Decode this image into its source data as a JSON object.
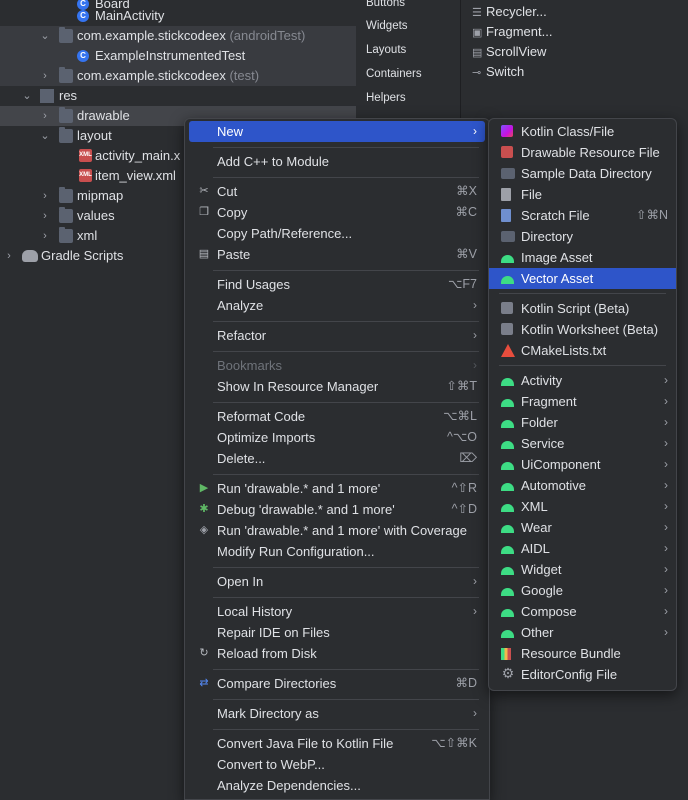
{
  "project_tree": {
    "rows": [
      {
        "label": "Board",
        "suffix": ""
      },
      {
        "label": "MainActivity",
        "suffix": ""
      },
      {
        "label": "com.example.stickcodeex",
        "suffix": "(androidTest)"
      },
      {
        "label": "ExampleInstrumentedTest",
        "suffix": ""
      },
      {
        "label": "com.example.stickcodeex",
        "suffix": "(test)"
      },
      {
        "label": "res",
        "suffix": ""
      },
      {
        "label": "drawable",
        "suffix": ""
      },
      {
        "label": "layout",
        "suffix": ""
      },
      {
        "label": "activity_main.x",
        "suffix": ""
      },
      {
        "label": "item_view.xml",
        "suffix": ""
      },
      {
        "label": "mipmap",
        "suffix": ""
      },
      {
        "label": "values",
        "suffix": ""
      },
      {
        "label": "xml",
        "suffix": ""
      },
      {
        "label": "Gradle Scripts",
        "suffix": ""
      }
    ]
  },
  "palette": {
    "categories": [
      "Buttons",
      "Widgets",
      "Layouts",
      "Containers",
      "Helpers"
    ],
    "items": [
      "Recycler...",
      "Fragment...",
      "ScrollView",
      "Switch"
    ]
  },
  "context_menu": {
    "items": [
      {
        "label": "New",
        "shortcut": "",
        "submenu": true,
        "highlighted": true
      },
      {
        "label": "Add C++ to Module",
        "shortcut": ""
      },
      {
        "label": "Cut",
        "shortcut": "⌘X",
        "icon": "scissors-icon"
      },
      {
        "label": "Copy",
        "shortcut": "⌘C",
        "icon": "copy-icon"
      },
      {
        "label": "Copy Path/Reference...",
        "shortcut": ""
      },
      {
        "label": "Paste",
        "shortcut": "⌘V",
        "icon": "paste-icon"
      },
      {
        "label": "Find Usages",
        "shortcut": "⌥F7"
      },
      {
        "label": "Analyze",
        "shortcut": "",
        "submenu": true
      },
      {
        "label": "Refactor",
        "shortcut": "",
        "submenu": true
      },
      {
        "label": "Bookmarks",
        "shortcut": "",
        "submenu": true,
        "disabled": true
      },
      {
        "label": "Show In Resource Manager",
        "shortcut": "⇧⌘T"
      },
      {
        "label": "Reformat Code",
        "shortcut": "⌥⌘L"
      },
      {
        "label": "Optimize Imports",
        "shortcut": "^⌥O"
      },
      {
        "label": "Delete...",
        "shortcut": "⌦"
      },
      {
        "label": "Run 'drawable.* and 1 more'",
        "shortcut": "^⇧R",
        "icon": "run-icon"
      },
      {
        "label": "Debug 'drawable.* and 1 more'",
        "shortcut": "^⇧D",
        "icon": "debug-icon"
      },
      {
        "label": "Run 'drawable.* and 1 more' with Coverage",
        "shortcut": "",
        "icon": "coverage-icon"
      },
      {
        "label": "Modify Run Configuration...",
        "shortcut": ""
      },
      {
        "label": "Open In",
        "shortcut": "",
        "submenu": true
      },
      {
        "label": "Local History",
        "shortcut": "",
        "submenu": true
      },
      {
        "label": "Repair IDE on Files",
        "shortcut": ""
      },
      {
        "label": "Reload from Disk",
        "shortcut": "",
        "icon": "reload-icon"
      },
      {
        "label": "Compare Directories",
        "shortcut": "⌘D",
        "icon": "compare-icon"
      },
      {
        "label": "Mark Directory as",
        "shortcut": "",
        "submenu": true
      },
      {
        "label": "Convert Java File to Kotlin File",
        "shortcut": "⌥⇧⌘K"
      },
      {
        "label": "Convert to WebP...",
        "shortcut": ""
      },
      {
        "label": "Analyze Dependencies...",
        "shortcut": ""
      }
    ]
  },
  "new_submenu": {
    "items": [
      {
        "label": "Kotlin Class/File",
        "shortcut": "",
        "icon": "kotlin-file-icon"
      },
      {
        "label": "Drawable Resource File",
        "shortcut": "",
        "icon": "drawable-resource-icon"
      },
      {
        "label": "Sample Data Directory",
        "shortcut": "",
        "icon": "folder-icon"
      },
      {
        "label": "File",
        "shortcut": "",
        "icon": "file-icon"
      },
      {
        "label": "Scratch File",
        "shortcut": "⇧⌘N",
        "icon": "scratch-file-icon"
      },
      {
        "label": "Directory",
        "shortcut": "",
        "icon": "folder-icon"
      },
      {
        "label": "Image Asset",
        "shortcut": "",
        "icon": "android-icon"
      },
      {
        "label": "Vector Asset",
        "shortcut": "",
        "icon": "android-icon",
        "highlighted": true
      },
      {
        "label": "Kotlin Script (Beta)",
        "shortcut": "",
        "icon": "kotlin-script-icon"
      },
      {
        "label": "Kotlin Worksheet (Beta)",
        "shortcut": "",
        "icon": "kotlin-worksheet-icon"
      },
      {
        "label": "CMakeLists.txt",
        "shortcut": "",
        "icon": "cmake-icon"
      },
      {
        "label": "Activity",
        "submenu": true,
        "icon": "android-icon"
      },
      {
        "label": "Fragment",
        "submenu": true,
        "icon": "android-icon"
      },
      {
        "label": "Folder",
        "submenu": true,
        "icon": "android-icon"
      },
      {
        "label": "Service",
        "submenu": true,
        "icon": "android-icon"
      },
      {
        "label": "UiComponent",
        "submenu": true,
        "icon": "android-icon"
      },
      {
        "label": "Automotive",
        "submenu": true,
        "icon": "android-icon"
      },
      {
        "label": "XML",
        "submenu": true,
        "icon": "android-icon"
      },
      {
        "label": "Wear",
        "submenu": true,
        "icon": "android-icon"
      },
      {
        "label": "AIDL",
        "submenu": true,
        "icon": "android-icon"
      },
      {
        "label": "Widget",
        "submenu": true,
        "icon": "android-icon"
      },
      {
        "label": "Google",
        "submenu": true,
        "icon": "android-icon"
      },
      {
        "label": "Compose",
        "submenu": true,
        "icon": "android-icon"
      },
      {
        "label": "Other",
        "submenu": true,
        "icon": "android-icon"
      },
      {
        "label": "Resource Bundle",
        "shortcut": "",
        "icon": "resource-bundle-icon"
      },
      {
        "label": "EditorConfig File",
        "shortcut": "",
        "icon": "gear-icon"
      }
    ]
  },
  "colors": {
    "background": "#2b2d30",
    "highlight": "#2e55c9",
    "android_green": "#3ddc84"
  }
}
